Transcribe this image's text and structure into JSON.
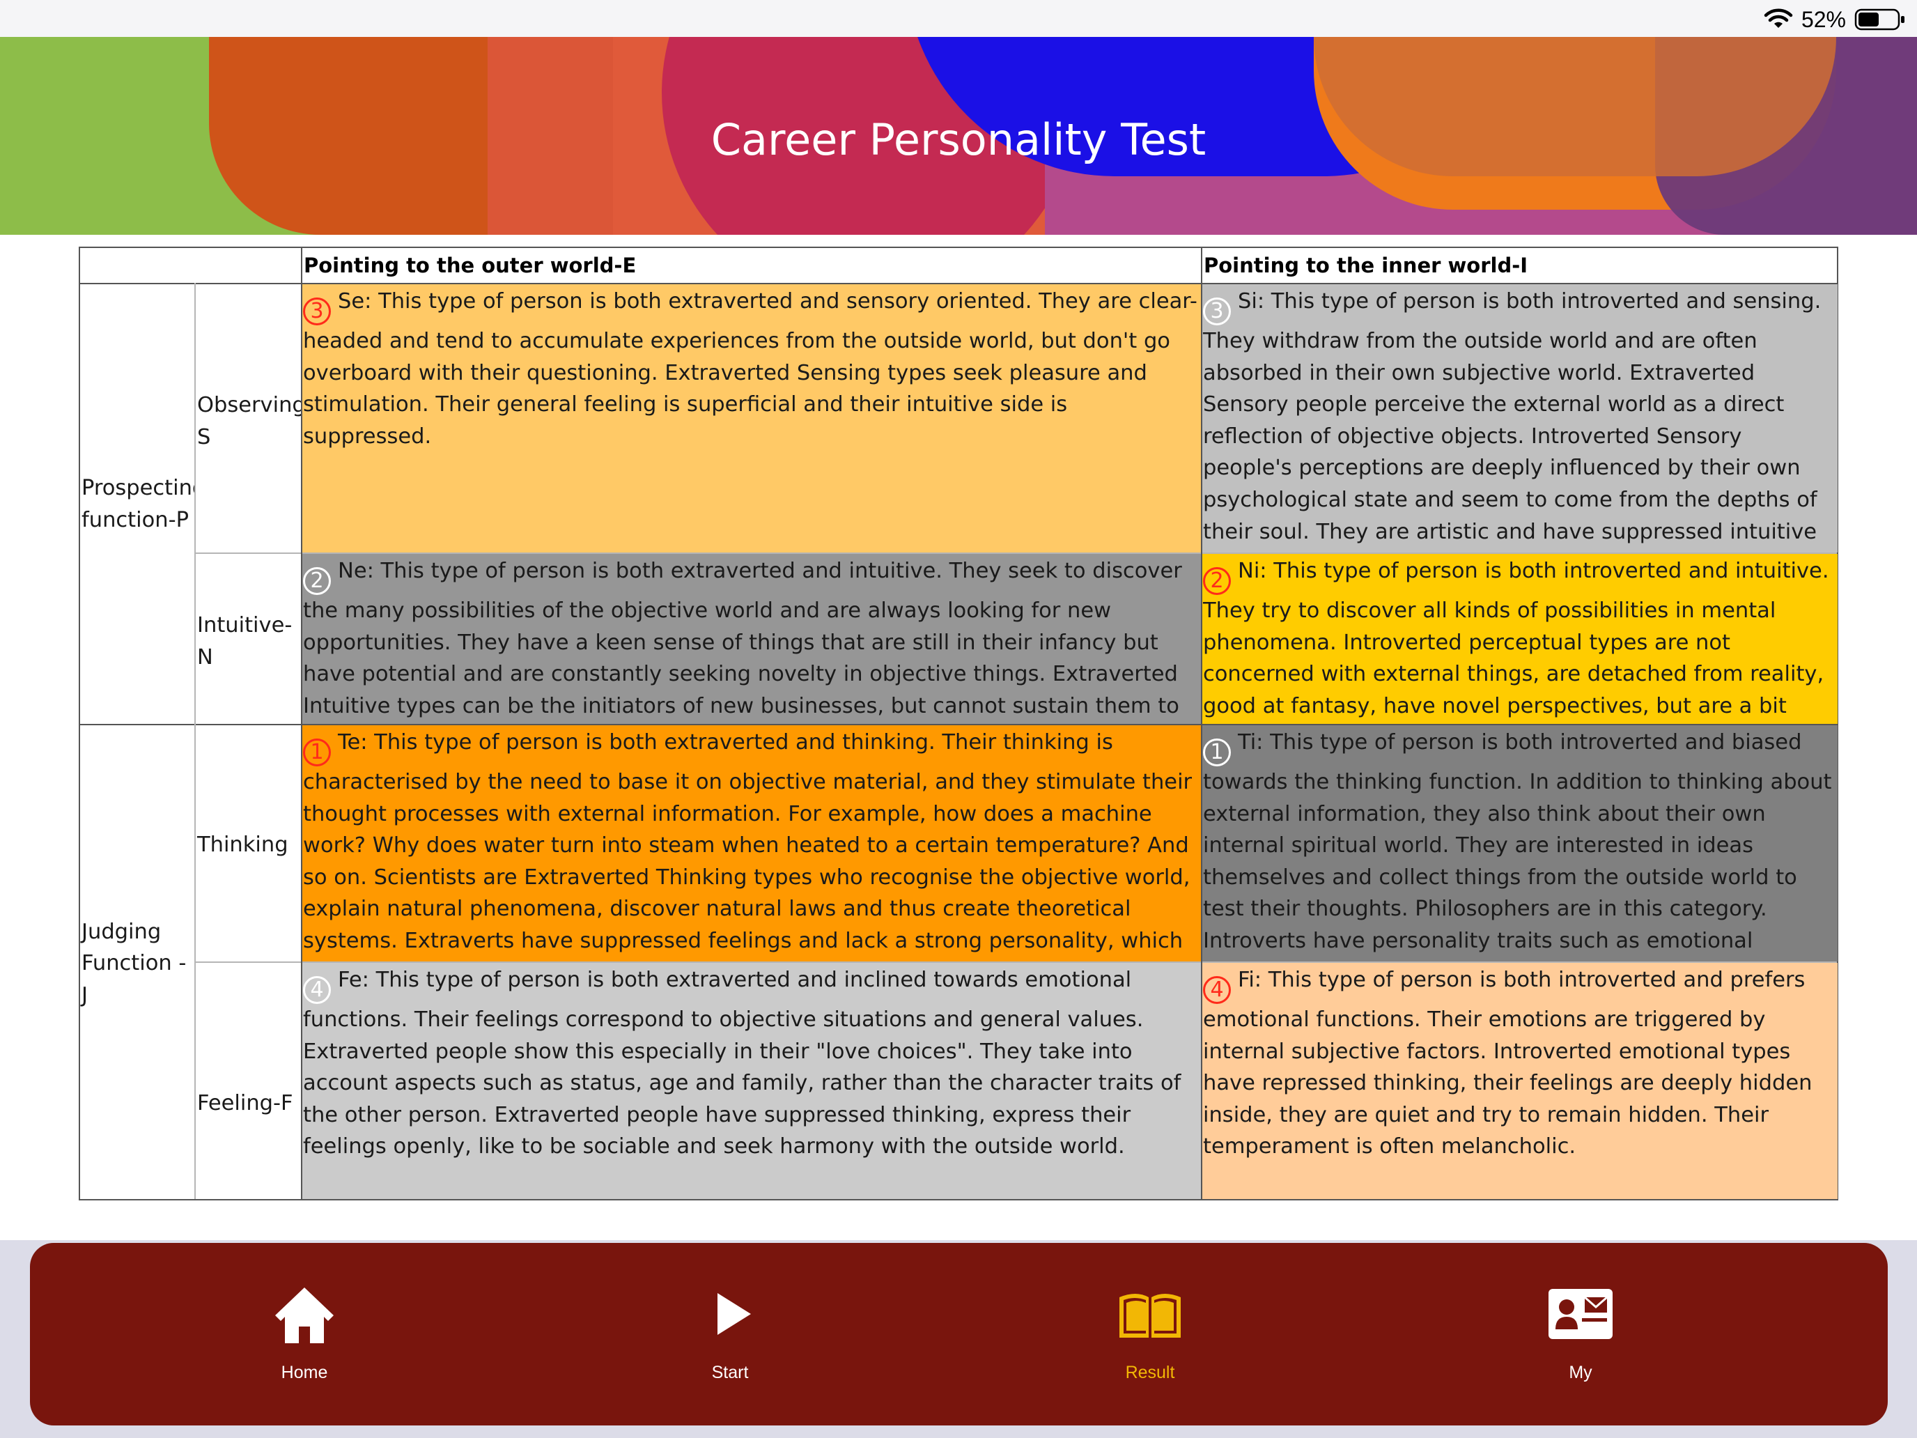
{
  "status_bar": {
    "battery_percent": "52%",
    "wifi_icon": "wifi-icon",
    "battery_icon": "battery-icon"
  },
  "header": {
    "title": "Career Personality Test"
  },
  "table": {
    "col_headers": {
      "outer": "Pointing to the outer world-E",
      "inner": "Pointing to the inner world-I"
    },
    "functions": {
      "perceiving": "Prospecting function-P",
      "judging": "Judging Function - J"
    },
    "rows": [
      {
        "label": "Observing-S",
        "outer": {
          "number": "3",
          "badge_color": "#ff2a1a",
          "bg": "#ffc966",
          "text": "Se: This type of person is both extraverted and sensory oriented. They are clear-headed and tend to accumulate experiences from the outside world, but don't go overboard with their questioning. Extraverted Sensing types seek pleasure and stimulation. Their general feeling is superficial and their intuitive side is suppressed."
        },
        "inner": {
          "number": "3",
          "badge_color": "#ffffff",
          "bg": "#c0c0c0",
          "text": "Si: This type of person is both introverted and sensing. They withdraw from the outside world and are often absorbed in their own subjective world. Extraverted Sensory people perceive the external world as a direct reflection of objective objects. Introverted Sensory people's perceptions are deeply influenced by their own psychological state and seem to come from the depths of their soul. They are artistic and have suppressed intuitive functions."
        }
      },
      {
        "label": "Intuitive-N",
        "outer": {
          "number": "2",
          "badge_color": "#ffffff",
          "bg": "#969696",
          "text": "Ne: This type of person is both extraverted and intuitive. They seek to discover the many possibilities of the objective world and are always looking for new opportunities. They have a keen sense of things that are still in their infancy but have potential and are constantly seeking novelty in objective things. Extraverted Intuitive types can be the initiators of new businesses, but cannot sustain them to the end. Traders, entrepreneurs and brokers usually fall into this category."
        },
        "inner": {
          "number": "2",
          "badge_color": "#ff2a1a",
          "bg": "#ffcc00",
          "text": "Ni: This type of person is both introverted and intuitive. They try to discover all kinds of possibilities in mental phenomena. Introverted perceptual types are not concerned with external things, are detached from reality, good at fantasy, have novel perspectives, but are a bit eccentric. Artists belong to the Introverted Intuitive type."
        }
      },
      {
        "label": "Thinking",
        "outer": {
          "number": "1",
          "badge_color": "#ff2a1a",
          "bg": "#ff9900",
          "text": "Te: This type of person is both extraverted and thinking. Their thinking is characterised by the need to base it on objective material, and they stimulate their thought processes with external information. For example, how does a machine work? Why does water turn into steam when heated to a certain temperature? And so on. Scientists are Extraverted Thinking types who recognise the objective world, explain natural phenomena, discover natural laws and thus create theoretical systems. Extraverts have suppressed feelings and lack a strong personality, which can even manifest in personality traits such as coldness and arrogance."
        },
        "inner": {
          "number": "1",
          "badge_color": "#ffffff",
          "bg": "#808080",
          "text": "Ti: This type of person is both introverted and biased towards the thinking function. In addition to thinking about external information, they also think about their own internal spiritual world. They are interested in ideas themselves and collect things from the outside world to test their thoughts. Philosophers are in this category. Introverts have personality traits such as emotional repression, apathy, reverie, stubbornness, obstinacy and pride."
        }
      },
      {
        "label": "Feeling-F",
        "outer": {
          "number": "4",
          "badge_color": "#ffffff",
          "bg": "#cbcbcb",
          "text": "Fe: This type of person is both extraverted and inclined towards emotional functions. Their feelings correspond to objective situations and general values. Extraverted people show this especially in their \"love choices\". They take into account aspects such as status, age and family, rather than the character traits of the other person. Extraverted people have suppressed thinking, express their feelings openly, like to be sociable and seek harmony with the outside world."
        },
        "inner": {
          "number": "4",
          "badge_color": "#ff2a1a",
          "bg": "#ffcc99",
          "text": "Fi: This type of person is both introverted and prefers emotional functions. Their emotions are triggered by internal subjective factors. Introverted emotional types have repressed thinking, their feelings are deeply hidden inside, they are quiet and try to remain hidden. Their temperament is often melancholic."
        }
      }
    ]
  },
  "tabbar": {
    "active": "Result",
    "active_color": "#f2b705",
    "background": "#79150d",
    "tabs": [
      {
        "label": "Home",
        "icon": "home-icon"
      },
      {
        "label": "Start",
        "icon": "play-icon"
      },
      {
        "label": "Result",
        "icon": "book-icon"
      },
      {
        "label": "My",
        "icon": "contact-card-icon"
      }
    ]
  }
}
